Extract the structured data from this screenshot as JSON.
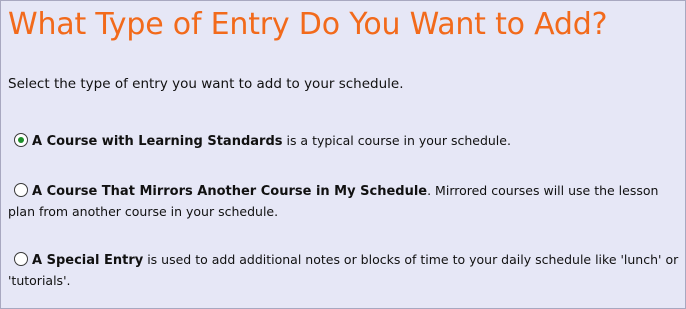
{
  "title": "What Type of Entry Do You Want to Add?",
  "intro": "Select the type of entry you want to add to your schedule.",
  "options": [
    {
      "label": "A Course with Learning Standards",
      "description": " is a typical course in your schedule.",
      "selected": true
    },
    {
      "label": "A Course That Mirrors Another Course in My Schedule",
      "description": ". Mirrored courses will use the lesson plan from another course in your schedule.",
      "selected": false
    },
    {
      "label": "A Special Entry",
      "description": " is used to add additional notes or blocks of time to your daily schedule like 'lunch' or 'tutorials'.",
      "selected": false
    }
  ],
  "colors": {
    "title": "#f26a1b",
    "panel_background": "#e6e7f6",
    "radio_selected": "#1d8f2a"
  }
}
